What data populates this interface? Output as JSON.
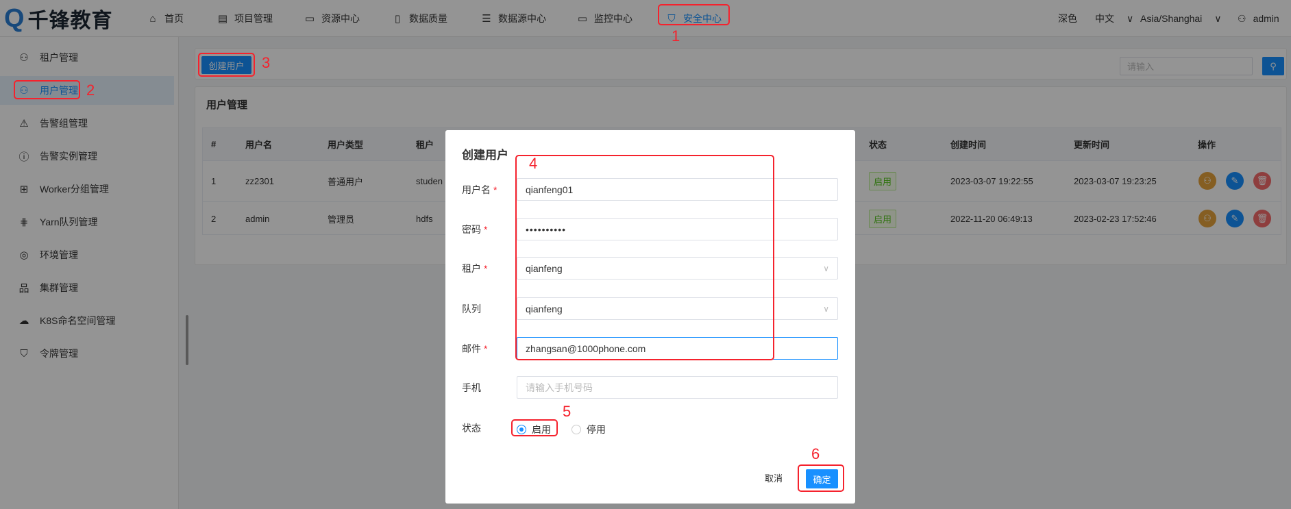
{
  "header": {
    "logo": "千锋教育",
    "nav": [
      {
        "label": "首页",
        "icon": "home-icon"
      },
      {
        "label": "项目管理",
        "icon": "project-icon"
      },
      {
        "label": "资源中心",
        "icon": "folder-icon"
      },
      {
        "label": "数据质量",
        "icon": "quality-icon"
      },
      {
        "label": "数据源中心",
        "icon": "database-icon"
      },
      {
        "label": "监控中心",
        "icon": "monitor-icon"
      },
      {
        "label": "安全中心",
        "icon": "shield-icon",
        "active": true
      }
    ],
    "theme": "深色",
    "language": "中文",
    "timezone": "Asia/Shanghai",
    "user": "admin"
  },
  "sidebar": {
    "items": [
      {
        "label": "租户管理",
        "icon": "tenant-icon"
      },
      {
        "label": "用户管理",
        "icon": "user-icon",
        "active": true
      },
      {
        "label": "告警组管理",
        "icon": "warning-icon"
      },
      {
        "label": "告警实例管理",
        "icon": "info-icon"
      },
      {
        "label": "Worker分组管理",
        "icon": "sliders-icon"
      },
      {
        "label": "Yarn队列管理",
        "icon": "grid-icon"
      },
      {
        "label": "环境管理",
        "icon": "location-icon"
      },
      {
        "label": "集群管理",
        "icon": "cluster-icon"
      },
      {
        "label": "K8S命名空间管理",
        "icon": "cloud-icon"
      },
      {
        "label": "令牌管理",
        "icon": "token-shield-icon"
      }
    ]
  },
  "toolbar": {
    "create_label": "创建用户",
    "search_placeholder": "请输入",
    "search_icon": "search-icon"
  },
  "card": {
    "title": "用户管理"
  },
  "table": {
    "columns": [
      "#",
      "用户名",
      "用户类型",
      "租户",
      "状态",
      "创建时间",
      "更新时间",
      "操作"
    ],
    "rows": [
      {
        "no": "1",
        "name": "zz2301",
        "type": "普通用户",
        "tenant": "studen",
        "status": "启用",
        "created": "2023-03-07 19:22:55",
        "updated": "2023-03-07 19:23:25"
      },
      {
        "no": "2",
        "name": "admin",
        "type": "管理员",
        "tenant": "hdfs",
        "status": "启用",
        "created": "2022-11-20 06:49:13",
        "updated": "2023-02-23 17:52:46"
      }
    ]
  },
  "modal": {
    "title": "创建用户",
    "fields": [
      {
        "label": "用户名",
        "required": true,
        "value": "qianfeng01"
      },
      {
        "label": "密码",
        "required": true,
        "value": "••••••••••"
      },
      {
        "label": "租户",
        "required": true,
        "value": "qianfeng"
      },
      {
        "label": "队列",
        "required": false,
        "value": "qianfeng"
      },
      {
        "label": "邮件",
        "required": true,
        "value": "zhangsan@1000phone.com"
      },
      {
        "label": "手机",
        "required": false,
        "placeholder": "请输入手机号码"
      }
    ],
    "status_label": "状态",
    "status_on": "启用",
    "status_off": "停用",
    "status_selected": "启用",
    "cancel": "取消",
    "ok": "确定",
    "required_mark": "*"
  },
  "annotations": [
    "1",
    "2",
    "3",
    "4",
    "5",
    "6"
  ],
  "colors": {
    "primary": "#1890ff",
    "annotation": "#f5222d",
    "success": "#52c41a",
    "warning": "#e6a23c",
    "danger": "#f56c6c"
  }
}
